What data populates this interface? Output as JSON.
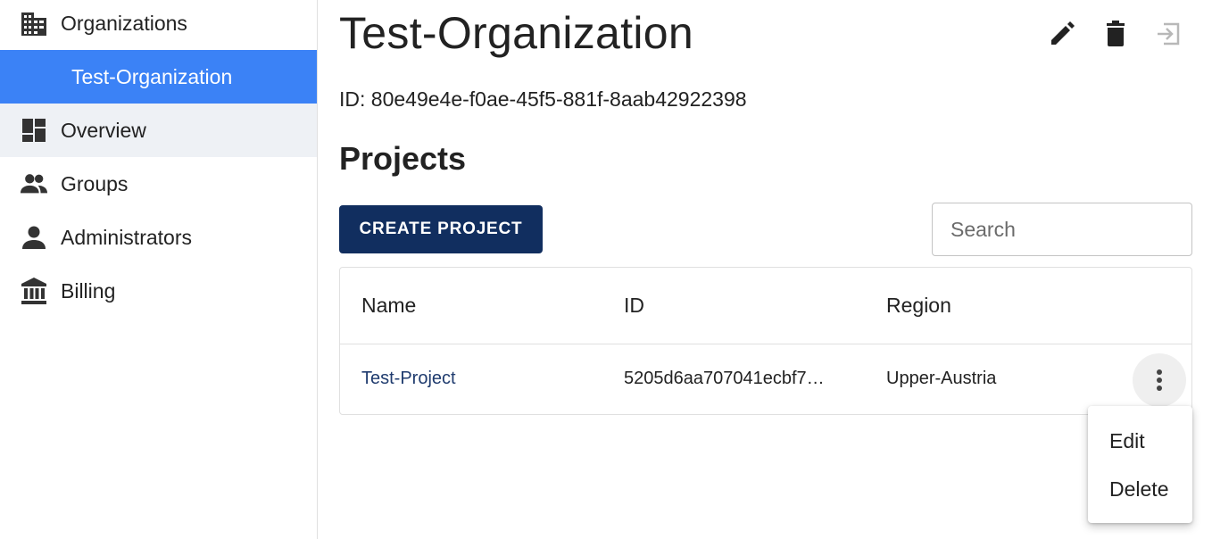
{
  "sidebar": {
    "items": [
      {
        "label": "Organizations",
        "icon": "building-icon"
      },
      {
        "label": "Test-Organization"
      },
      {
        "label": "Overview",
        "icon": "dashboard-icon"
      },
      {
        "label": "Groups",
        "icon": "people-icon"
      },
      {
        "label": "Administrators",
        "icon": "person-icon"
      },
      {
        "label": "Billing",
        "icon": "bank-icon"
      }
    ]
  },
  "header": {
    "title": "Test-Organization",
    "id_text": "ID: 80e49e4e-f0ae-45f5-881f-8aab42922398",
    "actions": [
      "edit-icon",
      "delete-icon",
      "exit-icon"
    ]
  },
  "projects": {
    "title": "Projects",
    "create_label": "CREATE PROJECT",
    "search_placeholder": "Search",
    "columns": [
      "Name",
      "ID",
      "Region"
    ],
    "rows": [
      {
        "name": "Test-Project",
        "id": "5205d6aa707041ecbf7…",
        "region": "Upper-Austria"
      }
    ]
  },
  "row_menu": {
    "items": [
      "Edit",
      "Delete"
    ]
  },
  "colors": {
    "accent": "#3b82f6",
    "primary_button": "#112e5f",
    "link": "#1f3b6e",
    "selected_bg": "#eef1f5"
  }
}
